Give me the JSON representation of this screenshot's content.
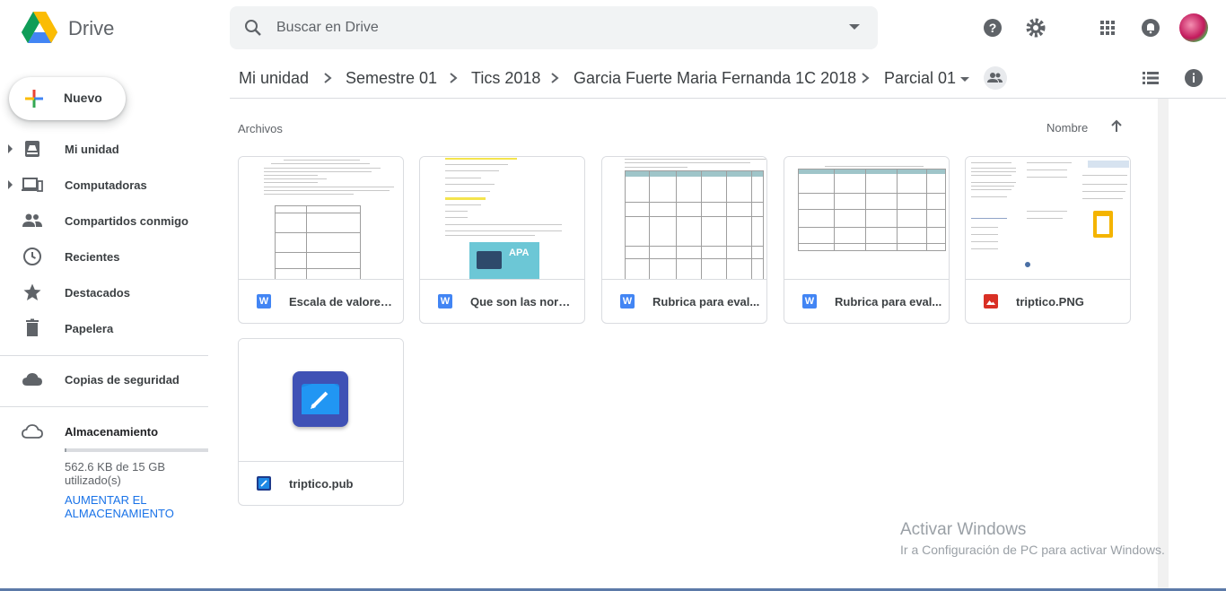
{
  "app": {
    "name": "Drive"
  },
  "search": {
    "placeholder": "Buscar en Drive"
  },
  "header_icons": [
    "help-icon",
    "settings-icon",
    "apps-icon",
    "notifications-icon",
    "avatar"
  ],
  "sidebar": {
    "new_label": "Nuevo",
    "items": [
      {
        "label": "Mi unidad",
        "icon": "drive-icon",
        "expandable": true
      },
      {
        "label": "Computadoras",
        "icon": "computers-icon",
        "expandable": true
      },
      {
        "label": "Compartidos conmigo",
        "icon": "people-icon",
        "expandable": false
      },
      {
        "label": "Recientes",
        "icon": "clock-icon",
        "expandable": false
      },
      {
        "label": "Destacados",
        "icon": "star-icon",
        "expandable": false
      },
      {
        "label": "Papelera",
        "icon": "trash-icon",
        "expandable": false
      }
    ],
    "backup_label": "Copias de seguridad",
    "storage": {
      "label": "Almacenamiento",
      "usage": "562.6 KB de 15 GB utilizado(s)",
      "upgrade": "AUMENTAR EL ALMACENAMIENTO",
      "fraction_used": 0.01
    }
  },
  "breadcrumb": [
    "Mi unidad",
    "Semestre 01",
    "Tics 2018",
    "Garcia Fuerte Maria Fernanda 1C 2018",
    "Parcial 01"
  ],
  "main": {
    "section": "Archivos",
    "sort_label": "Nombre",
    "files": [
      {
        "name": "Escala de valores ...",
        "type": "word"
      },
      {
        "name": "Que son las norm...",
        "type": "word"
      },
      {
        "name": "Rubrica para eval...",
        "type": "word"
      },
      {
        "name": "Rubrica para eval...",
        "type": "word"
      },
      {
        "name": "triptico.PNG",
        "type": "image"
      },
      {
        "name": "triptico.pub",
        "type": "publisher"
      }
    ]
  },
  "watermark": {
    "line1": "Activar Windows",
    "line2": "Ir a Configuración de PC para activar Windows."
  },
  "colors": {
    "accent": "#1a73e8",
    "word": "#4285f4",
    "image": "#d93025",
    "publisher": "#1e88e5"
  }
}
